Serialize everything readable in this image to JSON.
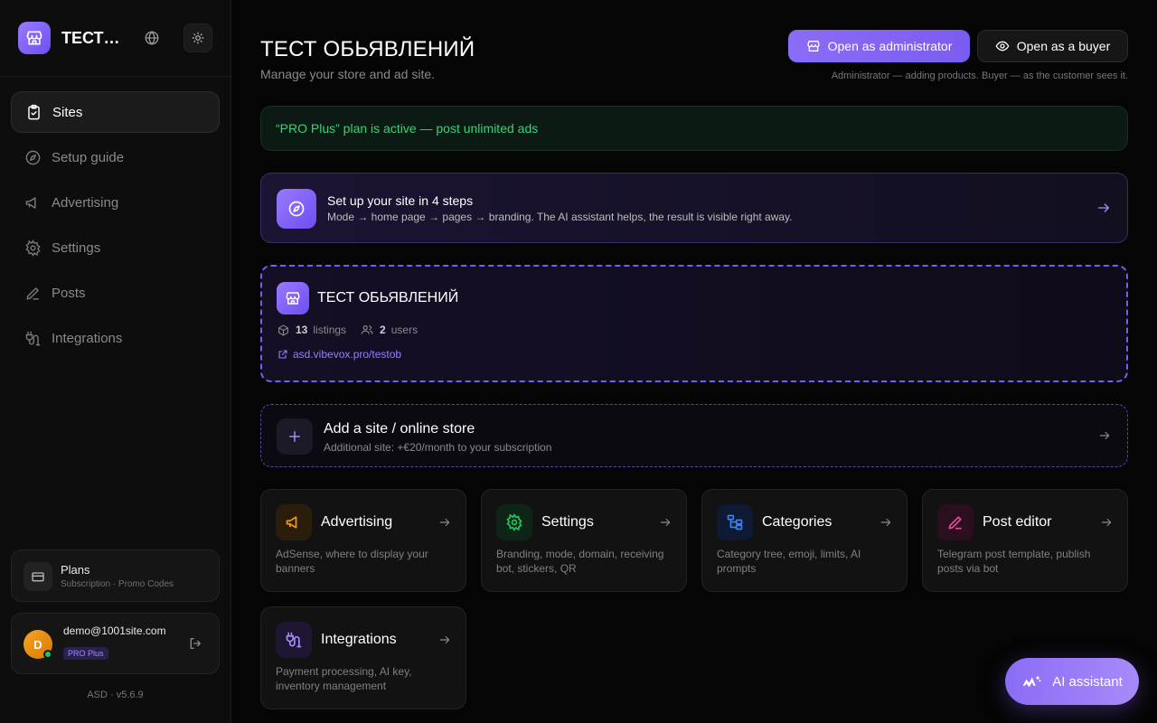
{
  "sidebar": {
    "brand_name": "ТЕСТ ...",
    "nav": [
      {
        "label": "Sites",
        "icon": "clipboard-check-icon",
        "active": true
      },
      {
        "label": "Setup guide",
        "icon": "compass-icon"
      },
      {
        "label": "Advertising",
        "icon": "megaphone-icon"
      },
      {
        "label": "Settings",
        "icon": "gear-icon"
      },
      {
        "label": "Posts",
        "icon": "pen-icon"
      },
      {
        "label": "Integrations",
        "icon": "plug-icon"
      }
    ],
    "plans": {
      "title": "Plans",
      "subtitle": "Subscription · Promo Codes"
    },
    "user": {
      "initial": "D",
      "email": "demo@1001site.com",
      "plan": "PRO Plus"
    },
    "version": "ASD · v5.6.9"
  },
  "header": {
    "title": "ТЕСТ ОБЬЯВЛЕНИЙ",
    "subtitle": "Manage your store and ad site.",
    "admin_button": "Open as administrator",
    "buyer_button": "Open as a buyer",
    "hint": "Administrator — adding products. Buyer — as the customer sees it."
  },
  "plan_banner": "“PRO Plus” plan is active — post unlimited ads",
  "setup": {
    "title": "Set up your site in 4 steps",
    "description": "Mode → home page → pages → branding. The AI assistant helps, the result is visible right away."
  },
  "site": {
    "name": "ТЕСТ ОБЬЯВЛЕНИЙ",
    "listings_count": "13",
    "listings_label": "listings",
    "users_count": "2",
    "users_label": "users",
    "link": "asd.vibevox.pro/testob"
  },
  "add_site": {
    "title": "Add a site / online store",
    "subtitle": "Additional site: +€20/month to your subscription"
  },
  "tiles": [
    {
      "title": "Advertising",
      "description": "AdSense, where to display your banners",
      "color": "#f59e0b"
    },
    {
      "title": "Settings",
      "description": "Branding, mode, domain, receiving bot, stickers, QR",
      "color": "#22c55e"
    },
    {
      "title": "Categories",
      "description": "Category tree, emoji, limits, AI prompts",
      "color": "#3b82f6"
    },
    {
      "title": "Post editor",
      "description": "Telegram post template, publish posts via bot",
      "color": "#ec4899"
    },
    {
      "title": "Integrations",
      "description": "Payment processing, AI key, inventory management",
      "color": "#a78bfa"
    }
  ],
  "ai_button": "AI assistant",
  "colors": {
    "accent": "#7c5cf0",
    "success": "#3fcf7a"
  }
}
